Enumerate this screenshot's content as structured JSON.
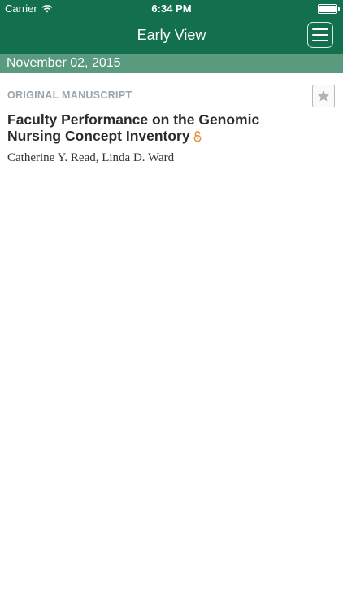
{
  "status_bar": {
    "carrier": "Carrier",
    "time": "6:34 PM"
  },
  "nav": {
    "title": "Early View"
  },
  "section": {
    "date": "November 02, 2015"
  },
  "article": {
    "category": "ORIGINAL MANUSCRIPT",
    "title": "Faculty Performance on the Genomic Nursing Concept Inventory",
    "authors": "Catherine Y. Read, Linda D. Ward",
    "open_access_icon": "open-lock-icon",
    "favorite_icon": "star-icon"
  },
  "colors": {
    "header_green": "#13704f",
    "date_bar_green": "#5a9b80",
    "open_access_orange": "#e8953a"
  }
}
